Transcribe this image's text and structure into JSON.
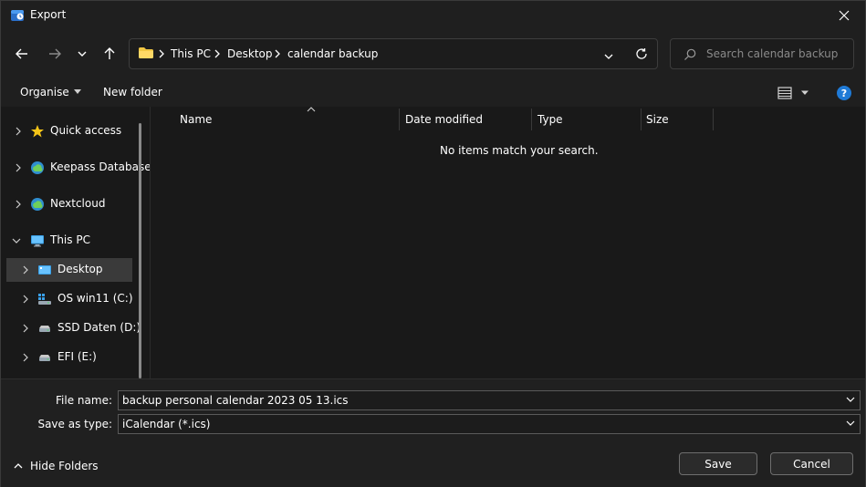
{
  "window": {
    "title": "Export",
    "close_icon": "close-icon"
  },
  "nav": {
    "back_icon": "arrow-left-icon",
    "forward_icon": "arrow-right-icon",
    "recent_icon": "chevron-down-icon",
    "up_icon": "arrow-up-icon",
    "breadcrumbs": [
      "This PC",
      "Desktop",
      "calendar backup"
    ],
    "search_placeholder": "Search calendar backup"
  },
  "commandbar": {
    "organise_label": "Organise",
    "new_folder_label": "New folder",
    "help_label": "?"
  },
  "navpane": {
    "items": [
      {
        "label": "Quick access",
        "icon": "star-icon"
      },
      {
        "label": "Keepass Database",
        "icon": "cloud-sync-icon"
      },
      {
        "label": "Nextcloud",
        "icon": "cloud-sync-icon"
      },
      {
        "label": "This PC",
        "icon": "monitor-icon"
      },
      {
        "label": "Desktop",
        "icon": "desktop-icon"
      },
      {
        "label": "OS win11 (C:)",
        "icon": "windows-drive-icon"
      },
      {
        "label": "SSD Daten (D:)",
        "icon": "drive-icon"
      },
      {
        "label": "EFI (E:)",
        "icon": "drive-icon"
      }
    ]
  },
  "filelist": {
    "columns": [
      "Name",
      "Date modified",
      "Type",
      "Size"
    ],
    "empty_message": "No items match your search."
  },
  "form": {
    "file_name_label": "File name:",
    "file_name_value": "backup personal calendar 2023 05 13.ics",
    "save_type_label": "Save as type:",
    "save_type_value": "iCalendar (*.ics)",
    "hide_folders_label": "Hide Folders",
    "save_label": "Save",
    "cancel_label": "Cancel"
  }
}
